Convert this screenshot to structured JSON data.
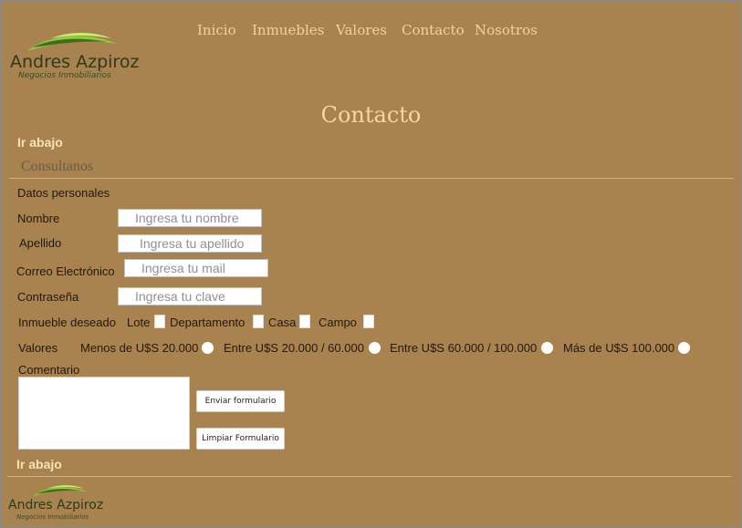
{
  "brand": {
    "name": "Andres Azpiroz",
    "tagline": "Negocios Inmobiliarios"
  },
  "nav": [
    {
      "label": "Inicio"
    },
    {
      "label": "Inmuebles"
    },
    {
      "label": "Valores"
    },
    {
      "label": "Contacto"
    },
    {
      "label": "Nosotros"
    }
  ],
  "page": {
    "title": "Contacto",
    "ir_abajo_top": "Ir abajo",
    "consult": "Consultanos",
    "ir_abajo_bottom": "Ir abajo"
  },
  "form": {
    "section_label": "Datos personales",
    "nombre": {
      "label": "Nombre",
      "placeholder": "Ingresa tu nombre"
    },
    "apellido": {
      "label": "Apellido",
      "placeholder": "Ingresa tu apellido"
    },
    "correo": {
      "label": "Correo Electrónico",
      "placeholder": "Ingresa tu mail"
    },
    "clave": {
      "label": "Contraseña",
      "placeholder": "Ingresa tu clave"
    },
    "inmueble": {
      "label": "Inmueble deseado",
      "options": [
        "Lote",
        "Departamento",
        "Casa",
        "Campo"
      ]
    },
    "valores": {
      "label": "Valores",
      "options": [
        "Menos de U$S 20.000",
        "Entre U$S 20.000 / 60.000",
        "Entre U$S 60.000 / 100.000",
        "Más de U$S 100.000"
      ]
    },
    "comentario_label": "Comentario",
    "submit_label": "Enviar formulario",
    "reset_label": "Limpiar Formulario"
  },
  "colors": {
    "background": "#a8824f",
    "nav_text": "#f1d39c",
    "title": "#f3d6a3",
    "logo_green": "#6fae34"
  }
}
